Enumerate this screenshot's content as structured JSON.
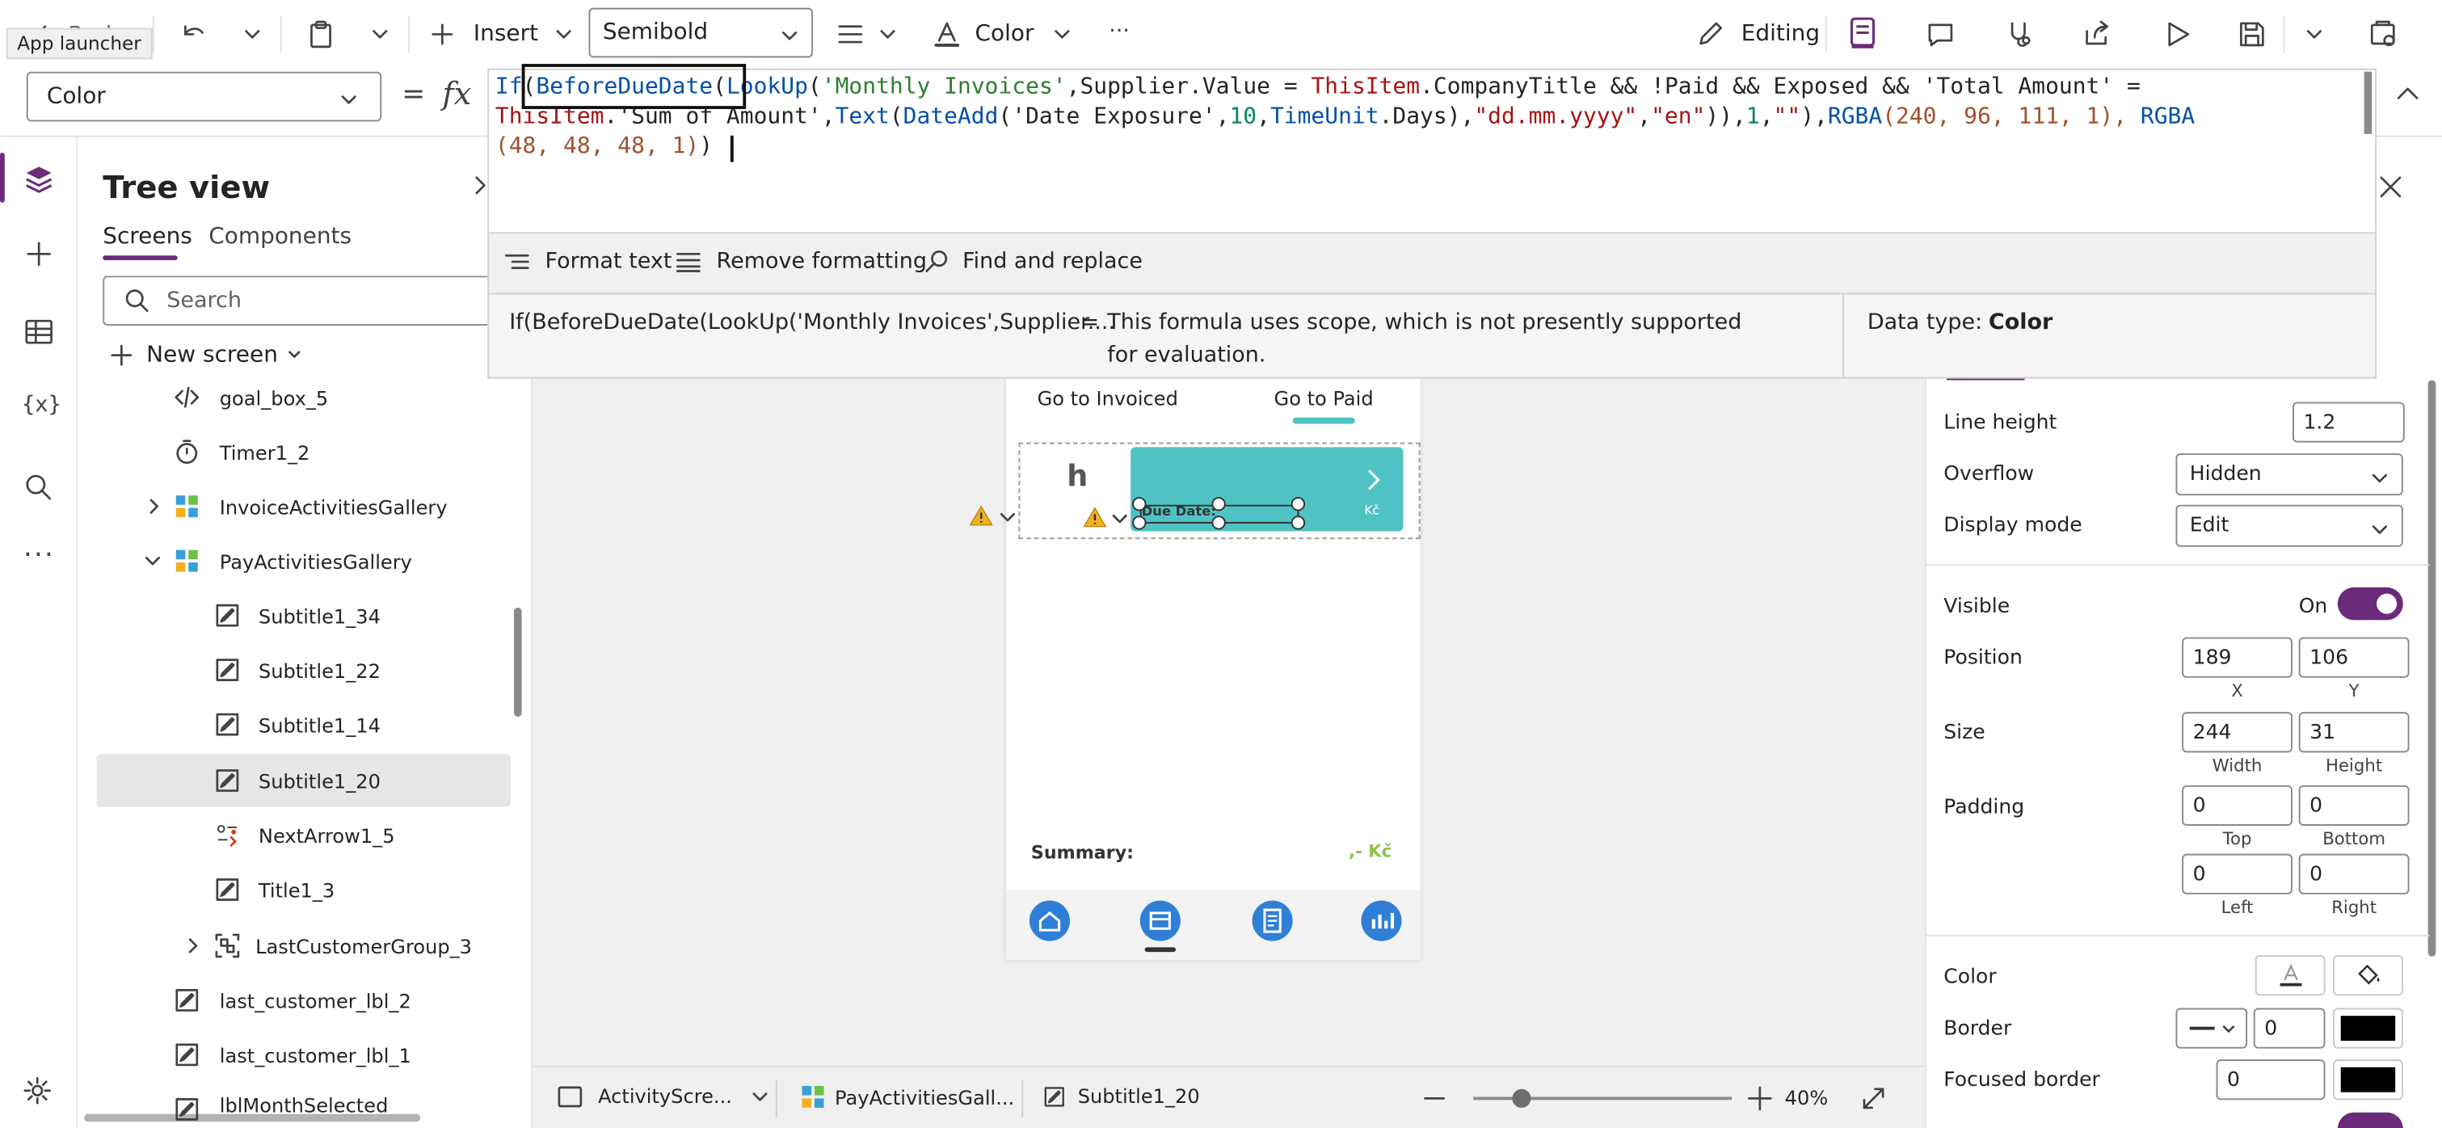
{
  "toolbar": {
    "back_label": "Back",
    "app_launcher_tooltip": "App launcher",
    "insert_label": "Insert",
    "font_weight": "Semibold",
    "color_label": "Color",
    "more_label": "···",
    "editing_label": "Editing"
  },
  "formula_bar": {
    "property": "Color",
    "equals": "=",
    "fx": "fx",
    "line1": [
      {
        "t": "If",
        "c": "#0451a5"
      },
      {
        "t": "(",
        "c": "#242424"
      },
      {
        "t": "BeforeDueDate",
        "c": "#0451a5"
      },
      {
        "t": "(",
        "c": "#242424"
      },
      {
        "t": "LookUp",
        "c": "#0451a5"
      },
      {
        "t": "(",
        "c": "#242424"
      },
      {
        "t": "'Monthly Invoices'",
        "c": "#2e7d32"
      },
      {
        "t": ",Supplier.Value = ",
        "c": "#242424"
      },
      {
        "t": "ThisItem",
        "c": "#a31515"
      },
      {
        "t": ".CompanyTitle && !",
        "c": "#242424"
      },
      {
        "t": "Paid",
        "c": "#242424"
      },
      {
        "t": " && Exposed && ",
        "c": "#242424"
      },
      {
        "t": "'Total Amount'",
        "c": "#242424"
      },
      {
        "t": " =",
        "c": "#242424"
      }
    ],
    "line2": [
      {
        "t": "ThisItem",
        "c": "#a31515"
      },
      {
        "t": ".'Sum of Amount',",
        "c": "#242424"
      },
      {
        "t": "Text",
        "c": "#0451a5"
      },
      {
        "t": "(",
        "c": "#242424"
      },
      {
        "t": "DateAdd",
        "c": "#0451a5"
      },
      {
        "t": "('Date Exposure',",
        "c": "#242424"
      },
      {
        "t": "10",
        "c": "#098658"
      },
      {
        "t": ",",
        "c": "#242424"
      },
      {
        "t": "TimeUnit",
        "c": "#0451a5"
      },
      {
        "t": ".Days),",
        "c": "#242424"
      },
      {
        "t": "\"dd.mm.yyyy\"",
        "c": "#a31515"
      },
      {
        "t": ",",
        "c": "#242424"
      },
      {
        "t": "\"en\"",
        "c": "#a31515"
      },
      {
        "t": ")),",
        "c": "#242424"
      },
      {
        "t": "1",
        "c": "#098658"
      },
      {
        "t": ",",
        "c": "#242424"
      },
      {
        "t": "\"\"",
        "c": "#a31515"
      },
      {
        "t": "),",
        "c": "#242424"
      },
      {
        "t": "RGBA",
        "c": "#0451a5"
      },
      {
        "t": "(240, 96, 111, 1), ",
        "c": "#a0522d"
      },
      {
        "t": "RGBA",
        "c": "#0451a5"
      }
    ],
    "line3": [
      {
        "t": "(48, 48, 48, 1)",
        "c": "#a0522d"
      },
      {
        "t": ")",
        "c": "#242424"
      }
    ],
    "format_text": "Format text",
    "remove_formatting": "Remove formatting",
    "find_replace": "Find and replace",
    "eval_expr": "If(BeforeDueDate(LookUp('Monthly Invoices',Supplier....",
    "eval_equals": "=",
    "eval_message": "This formula uses scope, which is not presently supported for evaluation.",
    "data_type_label": "Data type:",
    "data_type_value": "Color"
  },
  "tree": {
    "title": "Tree view",
    "tabs": [
      "Screens",
      "Components"
    ],
    "search_placeholder": "Search",
    "new_screen": "New screen",
    "items": [
      {
        "label": "goal_box_5",
        "icon": "code-icon"
      },
      {
        "label": "Timer1_2",
        "icon": "timer-icon"
      },
      {
        "label": "InvoiceActivitiesGallery",
        "icon": "gallery-icon"
      },
      {
        "label": "PayActivitiesGallery",
        "icon": "gallery-icon"
      },
      {
        "label": "Subtitle1_34",
        "icon": "label-icon"
      },
      {
        "label": "Subtitle1_22",
        "icon": "label-icon"
      },
      {
        "label": "Subtitle1_14",
        "icon": "label-icon"
      },
      {
        "label": "Subtitle1_20",
        "icon": "label-icon"
      },
      {
        "label": "NextArrow1_5",
        "icon": "next-arrow-icon"
      },
      {
        "label": "Title1_3",
        "icon": "label-icon"
      },
      {
        "label": "LastCustomerGroup_3",
        "icon": "group-icon"
      },
      {
        "label": "last_customer_lbl_2",
        "icon": "label-icon"
      },
      {
        "label": "last_customer_lbl_1",
        "icon": "label-icon"
      },
      {
        "label": "lblMonthSelected",
        "icon": "label-icon"
      }
    ]
  },
  "canvas": {
    "nav_invoiced": "Go to Invoiced",
    "nav_paid": "Go to Paid",
    "card_letter": "h",
    "due_date": "Due Date:",
    "currency": "Kč",
    "summary_label": "Summary:",
    "summary_value": ",- Kč",
    "accent": "#4fc3c3",
    "active_nav": "#4fc3c3"
  },
  "properties": {
    "line_height_label": "Line height",
    "line_height": "1.2",
    "overflow_label": "Overflow",
    "overflow": "Hidden",
    "display_mode_label": "Display mode",
    "display_mode": "Edit",
    "visible_label": "Visible",
    "visible_state": "On",
    "position_label": "Position",
    "x": "189",
    "y": "106",
    "x_label": "X",
    "y_label": "Y",
    "size_label": "Size",
    "width": "244",
    "height": "31",
    "width_label": "Width",
    "height_label": "Height",
    "padding_label": "Padding",
    "pad_top": "0",
    "pad_bottom": "0",
    "pad_left": "0",
    "pad_right": "0",
    "top_label": "Top",
    "bottom_label": "Bottom",
    "left_label": "Left",
    "right_label": "Right",
    "color_label": "Color",
    "border_label": "Border",
    "border_width": "0",
    "focused_border_label": "Focused border",
    "focused_border_width": "0",
    "toggle_color": "#6b2a7a"
  },
  "statusbar": {
    "screen": "ActivityScre...",
    "gallery": "PayActivitiesGall...",
    "control": "Subtitle1_20",
    "zoom": "40%",
    "zoom_fraction": 0.35
  }
}
